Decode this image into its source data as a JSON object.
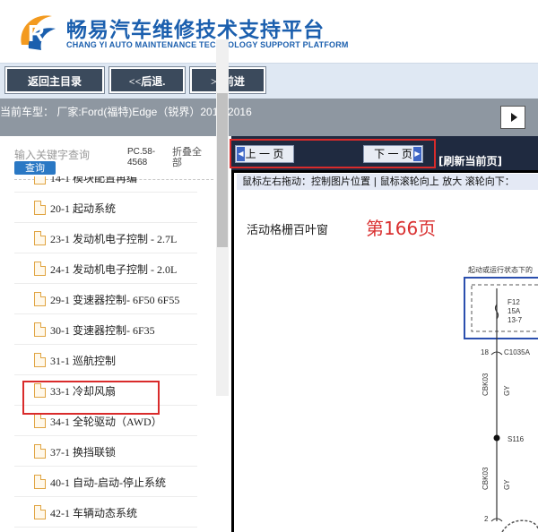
{
  "header": {
    "title_cn": "畅易汽车维修技术支持平台",
    "title_en": "CHANG YI AUTO MAINTENANCE TECHNOLOGY SUPPORT PLATFORM",
    "logo_letter": "R",
    "logo_icon": "changyi-logo-icon"
  },
  "nav": {
    "home": "返回主目录",
    "back": "<<后退.",
    "forward": ">>前进"
  },
  "model": {
    "text": "当前车型：  厂家:Ford(福特)Edge（锐界）2015-2016"
  },
  "search": {
    "placeholder": "输入关键字查询",
    "button": "查询",
    "pc_info": "PC.58-4568",
    "collapse": "折叠全部"
  },
  "tree": {
    "items": [
      {
        "label": "14-1 模块配置再编"
      },
      {
        "label": "20-1 起动系统"
      },
      {
        "label": "23-1 发动机电子控制 - 2.7L"
      },
      {
        "label": "24-1 发动机电子控制 - 2.0L"
      },
      {
        "label": "29-1 变速器控制- 6F50 6F55"
      },
      {
        "label": "30-1 变速器控制- 6F35"
      },
      {
        "label": "31-1 巡航控制"
      },
      {
        "label": "33-1 冷却风扇"
      },
      {
        "label": "34-1 全轮驱动（AWD）"
      },
      {
        "label": "37-1 换挡联锁"
      },
      {
        "label": "40-1 自动-启动-停止系统"
      },
      {
        "label": "42-1 车辆动态系统"
      }
    ]
  },
  "pager": {
    "prev": "上 一 页",
    "next": "下 一 页",
    "refresh": "[刷新当前页]",
    "hint": "鼠标左右拖动：控制图片位置 | 鼠标滚轮向上 放大   滚轮向下："
  },
  "diagram": {
    "title": "活动格栅百叶窗",
    "page": "第166页",
    "caption": "起动或运行状态下的",
    "fuse_name": "F12",
    "fuse_rating": "15A",
    "fuse_loc": "13-7",
    "pin_top": "18",
    "connector": "C1035A",
    "wire1": "CBK03",
    "wire1_color": "GY",
    "splice": "S116",
    "wire2": "CBK03",
    "wire2_color": "GY",
    "pin_bottom": "2"
  },
  "colors": {
    "brand_blue": "#1b5fae",
    "nav_button": "#3b4a5c",
    "highlight_red": "#d92b2b",
    "page_number_red": "#d93030",
    "search_blue": "#2a78c4"
  }
}
